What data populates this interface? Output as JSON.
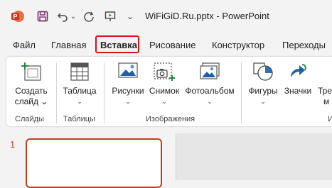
{
  "window": {
    "title": "WiFiGiD.Ru.pptx  -  PowerPoint"
  },
  "quick_access": {
    "app_letter": "P",
    "dropdown_glyph": "⌄"
  },
  "tabs": [
    {
      "label": "Файл"
    },
    {
      "label": "Главная"
    },
    {
      "label": "Вставка",
      "active": true
    },
    {
      "label": "Рисование"
    },
    {
      "label": "Конструктор"
    },
    {
      "label": "Переходы"
    }
  ],
  "ribbon": {
    "buttons": [
      {
        "label1": "Создать",
        "label2": "слайд ⌄"
      },
      {
        "label1": "Таблица",
        "label2": "⌄"
      },
      {
        "label1": "Рисунки",
        "label2": "⌄"
      },
      {
        "label1": "Снимок",
        "label2": "⌄"
      },
      {
        "label1": "Фотоальбом",
        "label2": "⌄"
      },
      {
        "label1": "Фигуры",
        "label2": "⌄"
      },
      {
        "label1": "Значки",
        "label2": ""
      },
      {
        "label1": "Тре",
        "label2": "м"
      }
    ],
    "groups": [
      {
        "label": "Слайды"
      },
      {
        "label": "Таблицы"
      },
      {
        "label": "Изображения"
      },
      {
        "label": "И"
      }
    ]
  },
  "slides_panel": {
    "slide_number": "1"
  },
  "colors": {
    "accent": "#c43e1c",
    "highlight": "#d2121c",
    "icon_blue": "#1f5fa8"
  }
}
